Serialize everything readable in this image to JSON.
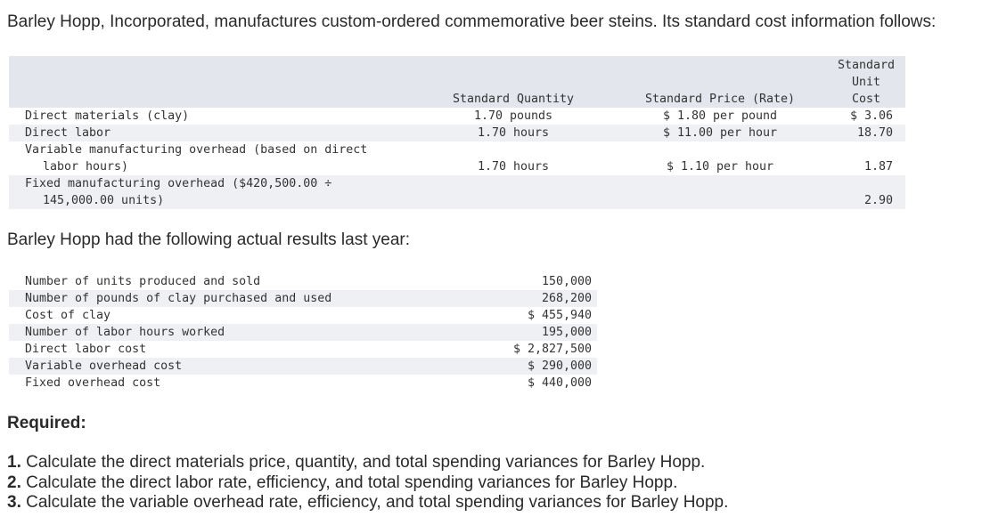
{
  "intro": "Barley Hopp, Incorporated, manufactures custom-ordered commemorative beer steins. Its standard cost information follows:",
  "standard_table": {
    "headers": {
      "quantity": "Standard Quantity",
      "price": "Standard Price (Rate)",
      "unit_cost_line1": "Standard",
      "unit_cost_line2": "Unit",
      "unit_cost_line3": "Cost"
    },
    "rows": [
      {
        "label": "Direct materials (clay)",
        "label2": "",
        "quantity": "1.70 pounds",
        "price": "$ 1.80 per pound",
        "unit_cost": "$ 3.06"
      },
      {
        "label": "Direct labor",
        "label2": "",
        "quantity": "1.70 hours",
        "price": "$ 11.00 per hour",
        "unit_cost": "18.70"
      },
      {
        "label": "Variable manufacturing overhead (based on direct",
        "label2": "labor hours)",
        "quantity": "1.70 hours",
        "price": "$ 1.10 per hour",
        "unit_cost": "1.87"
      },
      {
        "label": "Fixed manufacturing overhead ($420,500.00 ÷",
        "label2": "145,000.00 units)",
        "quantity": "",
        "price": "",
        "unit_cost": "2.90"
      }
    ]
  },
  "subhead": "Barley Hopp had the following actual results last year:",
  "actual_table": [
    {
      "label": "Number of units produced and sold",
      "value": "150,000"
    },
    {
      "label": "Number of pounds of clay purchased and used",
      "value": "268,200"
    },
    {
      "label": "Cost of clay",
      "value": "$ 455,940"
    },
    {
      "label": "Number of labor hours worked",
      "value": "195,000"
    },
    {
      "label": "Direct labor cost",
      "value": "$ 2,827,500"
    },
    {
      "label": "Variable overhead cost",
      "value": "$ 290,000"
    },
    {
      "label": "Fixed overhead cost",
      "value": "$ 440,000"
    }
  ],
  "required": "Required:",
  "questions": [
    {
      "num": "1.",
      "text": "Calculate the direct materials price, quantity, and total spending variances for Barley Hopp."
    },
    {
      "num": "2.",
      "text": "Calculate the direct labor rate, efficiency, and total spending variances for Barley Hopp."
    },
    {
      "num": "3.",
      "text": "Calculate the variable overhead rate, efficiency, and total spending variances for Barley Hopp."
    }
  ]
}
